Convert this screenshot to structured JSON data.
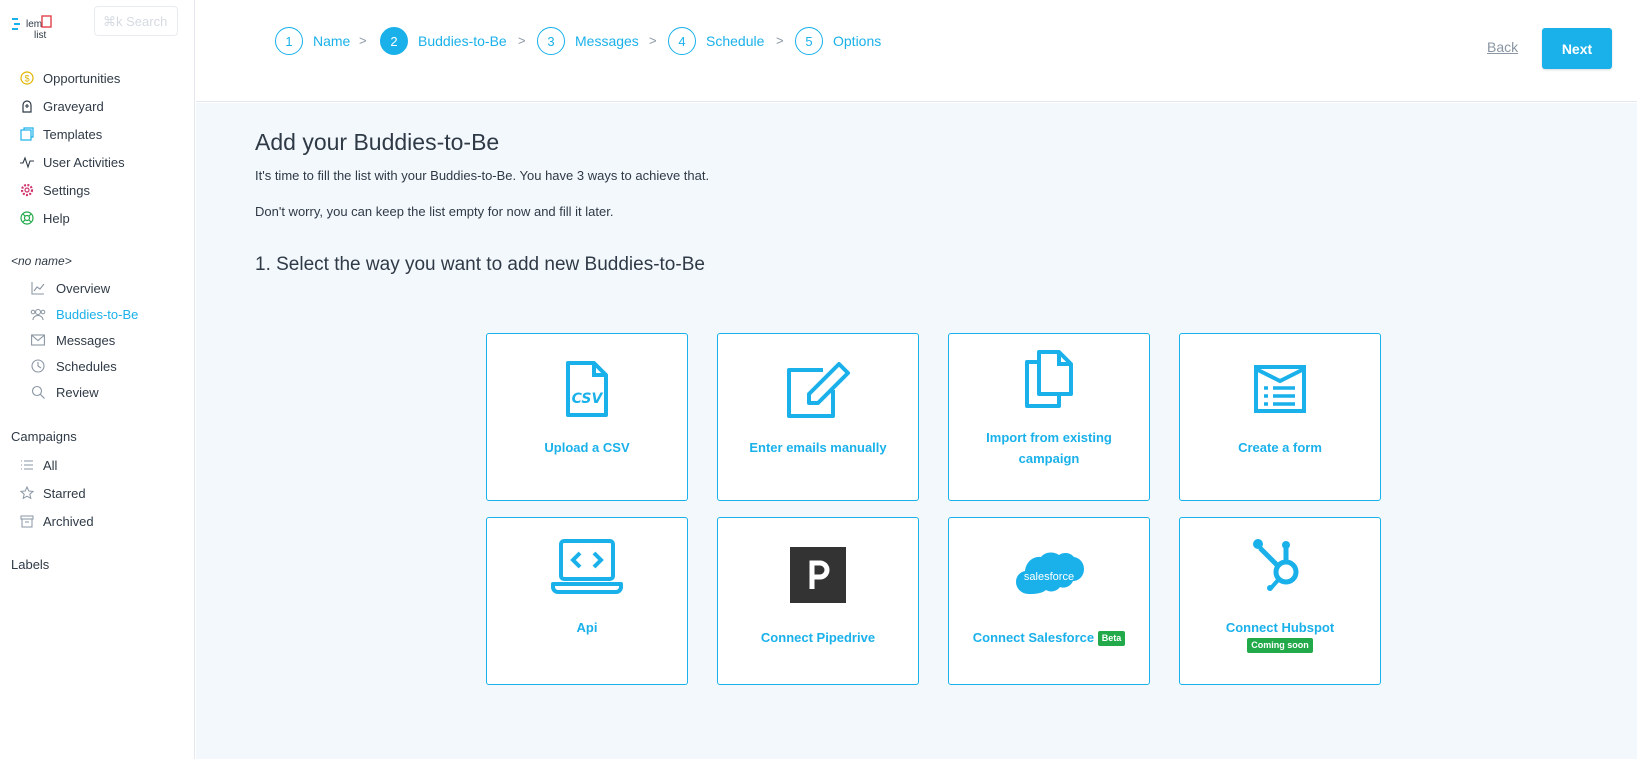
{
  "sidebar": {
    "search_placeholder": "⌘k Search",
    "nav": [
      {
        "label": "Opportunities",
        "icon": "dollar-circle-icon"
      },
      {
        "label": "Graveyard",
        "icon": "tombstone-icon"
      },
      {
        "label": "Templates",
        "icon": "templates-icon"
      },
      {
        "label": "User Activities",
        "icon": "activity-icon"
      },
      {
        "label": "Settings",
        "icon": "gear-icon"
      },
      {
        "label": "Help",
        "icon": "lifebuoy-icon"
      }
    ],
    "campaign_name": "<no name>",
    "campaign_items": [
      {
        "label": "Overview",
        "icon": "chart-icon"
      },
      {
        "label": "Buddies-to-Be",
        "icon": "people-icon"
      },
      {
        "label": "Messages",
        "icon": "envelope-icon"
      },
      {
        "label": "Schedules",
        "icon": "clock-icon"
      },
      {
        "label": "Review",
        "icon": "magnifier-icon"
      }
    ],
    "campaigns_label": "Campaigns",
    "campaigns": [
      {
        "label": "All",
        "icon": "list-icon"
      },
      {
        "label": "Starred",
        "icon": "star-icon"
      },
      {
        "label": "Archived",
        "icon": "archive-icon"
      }
    ],
    "labels_label": "Labels"
  },
  "steps": [
    {
      "num": "1",
      "label": "Name"
    },
    {
      "num": "2",
      "label": "Buddies-to-Be",
      "active": true
    },
    {
      "num": "3",
      "label": "Messages"
    },
    {
      "num": "4",
      "label": "Schedule"
    },
    {
      "num": "5",
      "label": "Options"
    }
  ],
  "step_separator": ">",
  "header": {
    "back_label": "Back",
    "next_label": "Next"
  },
  "main": {
    "title": "Add your Buddies-to-Be",
    "intro1": "It's time to fill the list with your Buddies-to-Be. You have 3 ways to achieve that.",
    "intro2": "Don't worry, you can keep the list empty for now and fill it later.",
    "section_title": "1. Select the way you want to add new Buddies-to-Be",
    "cards": [
      {
        "label": "Upload a CSV",
        "icon": "csv-file-icon"
      },
      {
        "label": "Enter emails manually",
        "icon": "edit-pencil-icon"
      },
      {
        "label": "Import from existing campaign",
        "icon": "copy-files-icon"
      },
      {
        "label": "Create a form",
        "icon": "form-icon"
      },
      {
        "label": "Api",
        "icon": "laptop-code-icon"
      },
      {
        "label": "Connect Pipedrive",
        "icon": "pipedrive-logo"
      },
      {
        "label": "Connect Salesforce",
        "icon": "salesforce-logo",
        "badge": "Beta"
      },
      {
        "label": "Connect Hubspot",
        "icon": "hubspot-logo",
        "badge": "Coming soon"
      }
    ],
    "salesforce_logo_text": "salesforce"
  },
  "colors": {
    "accent": "#1ab1ea",
    "badge_green": "#22a94a",
    "content_bg": "#f3f8fd"
  }
}
